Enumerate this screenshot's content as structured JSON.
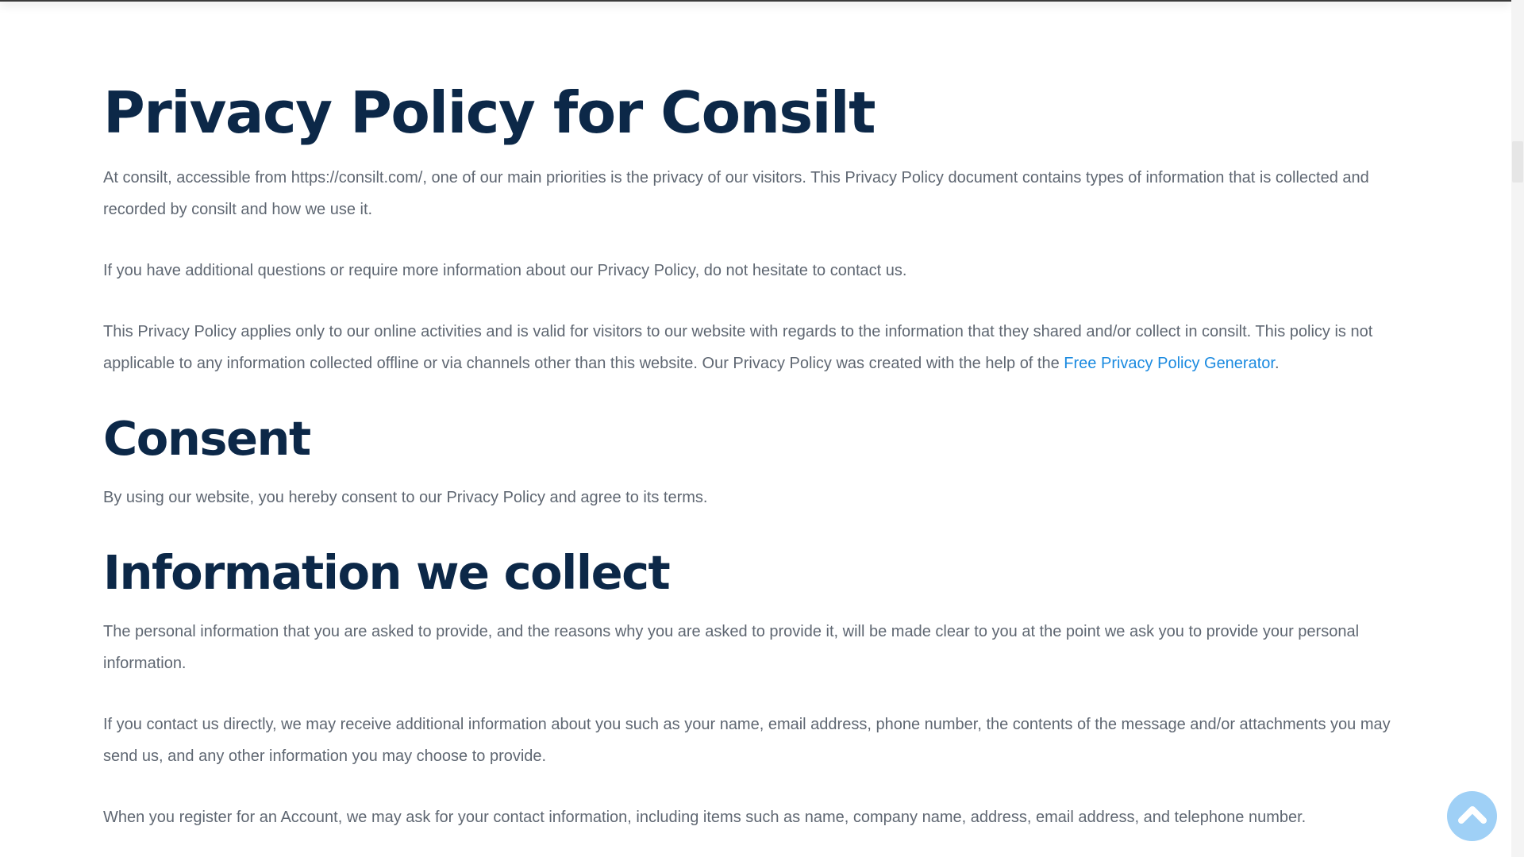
{
  "title": "Privacy Policy for Consilt",
  "intro": {
    "p1": "At consilt, accessible from https://consilt.com/, one of our main priorities is the privacy of our visitors. This Privacy Policy document contains types of information that is collected and recorded by consilt and how we use it.",
    "p2": "If you have additional questions or require more information about our Privacy Policy, do not hesitate to contact us.",
    "p3_text": "This Privacy Policy applies only to our online activities and is valid for visitors to our website with regards to the information that they shared and/or collect in consilt. This policy is not applicable to any information collected offline or via channels other than this website. Our Privacy Policy was created with the help of the ",
    "p3_link": "Free Privacy Policy Generator",
    "p3_end": "."
  },
  "consent": {
    "heading": "Consent",
    "p1": "By using our website, you hereby consent to our Privacy Policy and agree to its terms."
  },
  "information": {
    "heading": "Information we collect",
    "p1": "The personal information that you are asked to provide, and the reasons why you are asked to provide it, will be made clear to you at the point we ask you to provide your personal information.",
    "p2": "If you contact us directly, we may receive additional information about you such as your name, email address, phone number, the contents of the message and/or attachments you may send us, and any other information you may choose to provide.",
    "p3": "When you register for an Account, we may ask for your contact information, including items such as name, company name, address, email address, and telephone number."
  },
  "scroll_top": {
    "icon": "chevron-up-icon"
  },
  "colors": {
    "heading": "#0c2848",
    "body_text": "#5f6772",
    "link": "#1a8ae0",
    "scroll_button": "#9fd0f6"
  }
}
